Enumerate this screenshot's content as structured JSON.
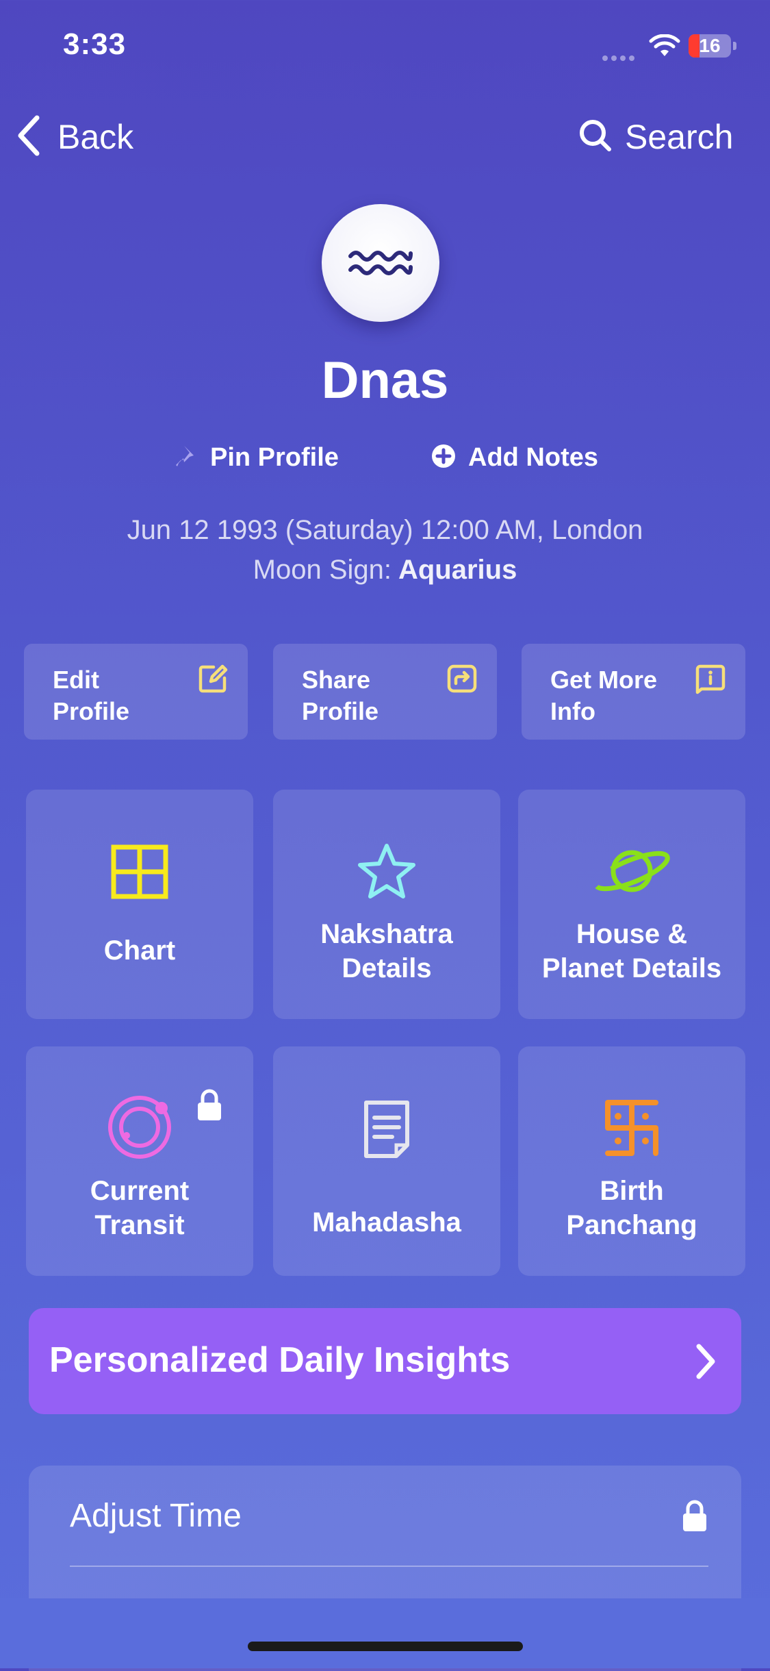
{
  "status_bar": {
    "time": "3:33",
    "battery": "16"
  },
  "nav": {
    "back_label": "Back",
    "search_label": "Search"
  },
  "profile": {
    "avatar_icon": "aquarius-icon",
    "name": "Dnas",
    "pin_label": "Pin Profile",
    "notes_label": "Add Notes",
    "birth_details": "Jun 12 1993 (Saturday) 12:00 AM, London",
    "moon_sign_label": "Moon Sign:",
    "moon_sign_value": "Aquarius"
  },
  "actions": [
    {
      "label": "Edit\nProfile",
      "icon": "edit-icon"
    },
    {
      "label": "Share\nProfile",
      "icon": "share-icon"
    },
    {
      "label": "Get More\nInfo",
      "icon": "info-icon"
    }
  ],
  "tiles": [
    {
      "label": "Chart",
      "icon": "chart-grid-icon",
      "color": "#f7ea1c"
    },
    {
      "label": "Nakshatra\nDetails",
      "icon": "star-icon",
      "color": "#8ff0f2"
    },
    {
      "label": "House &\nPlanet Details",
      "icon": "planet-icon",
      "color": "#8ae01a"
    },
    {
      "label": "Current\nTransit",
      "icon": "transit-orbit-icon",
      "color": "#ee6ae2",
      "locked": true
    },
    {
      "label": "Mahadasha",
      "icon": "document-icon",
      "color": "#e6e6ee"
    },
    {
      "label": "Birth\nPanchang",
      "icon": "swastika-icon",
      "color": "#f5912a"
    }
  ],
  "banner": {
    "label": "Personalized Daily Insights",
    "color": "#9560f5"
  },
  "adjust_time": {
    "label": "Adjust Time"
  }
}
